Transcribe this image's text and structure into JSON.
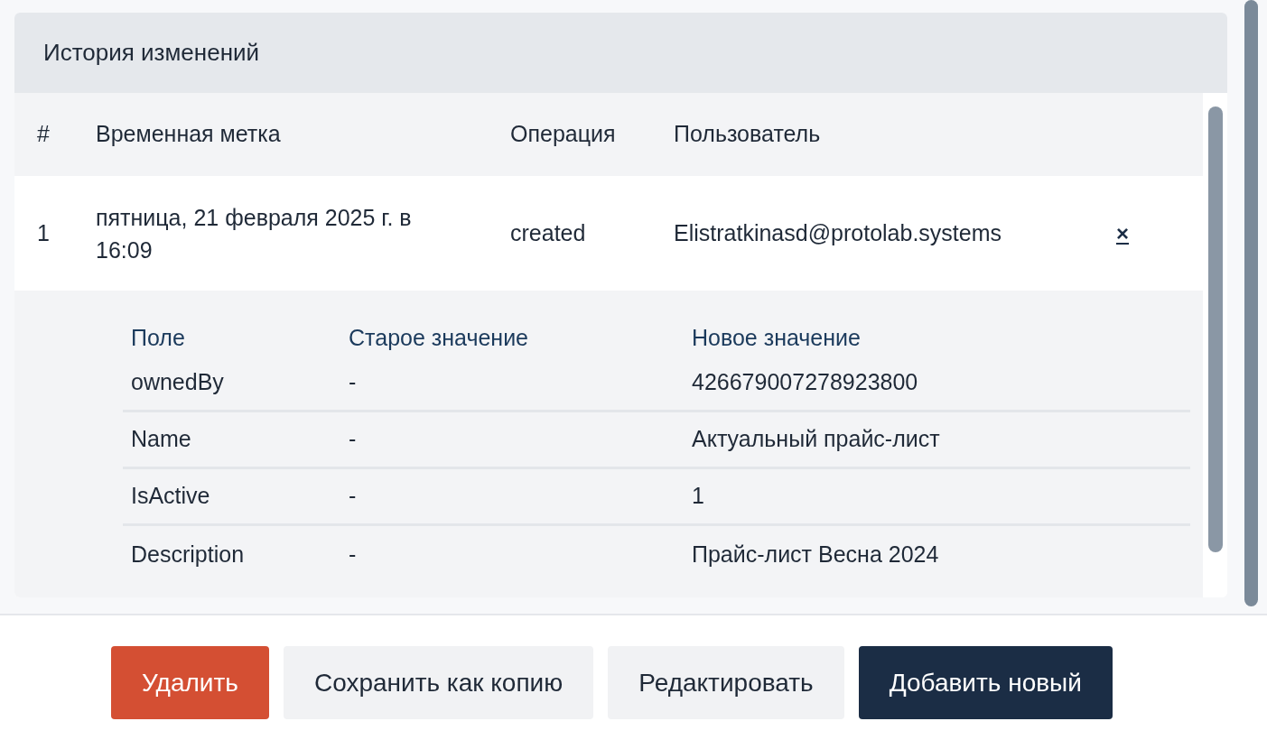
{
  "panel": {
    "title": "История изменений"
  },
  "table": {
    "columns": [
      "#",
      "Временная метка",
      "Операция",
      "Пользователь"
    ],
    "rows": [
      {
        "index": "1",
        "timestamp": "пятница, 21 февраля 2025 г. в 16:09",
        "operation": "created",
        "user": "Elistratkinasd@protolab.systems",
        "close": "×",
        "expanded": true,
        "details": {
          "columns": [
            "Поле",
            "Старое значение",
            "Новое значение"
          ],
          "rows": [
            {
              "field": "ownedBy",
              "old": "-",
              "new": "426679007278923800"
            },
            {
              "field": "Name",
              "old": "-",
              "new": "Актуальный прайс-лист"
            },
            {
              "field": "IsActive",
              "old": "-",
              "new": "1"
            },
            {
              "field": "Description",
              "old": "-",
              "new": "Прайс-лист Весна 2024"
            }
          ]
        }
      }
    ]
  },
  "buttons": [
    {
      "label": "Удалить",
      "kind": "danger"
    },
    {
      "label": "Сохранить как копию",
      "kind": "secondary"
    },
    {
      "label": "Редактировать",
      "kind": "secondary"
    },
    {
      "label": "Добавить новый",
      "kind": "primary"
    }
  ]
}
